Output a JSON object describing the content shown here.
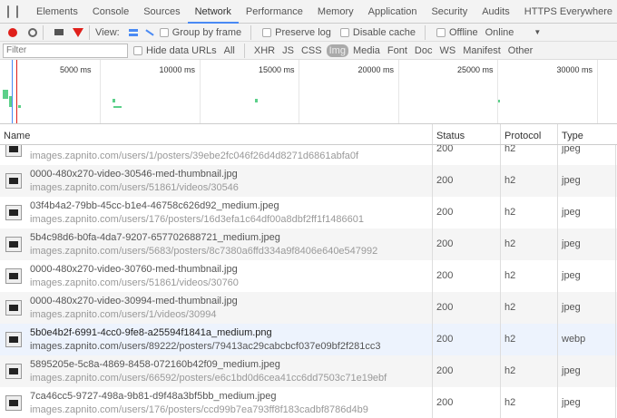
{
  "tabs": [
    "Elements",
    "Console",
    "Sources",
    "Network",
    "Performance",
    "Memory",
    "Application",
    "Security",
    "Audits",
    "HTTPS Everywhere"
  ],
  "active_tab": "Network",
  "toolbar": {
    "view_label": "View:",
    "group_by_frame": "Group by frame",
    "preserve_log": "Preserve log",
    "disable_cache": "Disable cache",
    "offline": "Offline",
    "throttle": "Online"
  },
  "filterbar": {
    "placeholder": "Filter",
    "hide_data_urls": "Hide data URLs",
    "types": [
      "All",
      "XHR",
      "JS",
      "CSS",
      "Img",
      "Media",
      "Font",
      "Doc",
      "WS",
      "Manifest",
      "Other"
    ],
    "selected_type": "Img"
  },
  "overview": {
    "ticks": [
      "5000 ms",
      "10000 ms",
      "15000 ms",
      "20000 ms",
      "25000 ms",
      "30000 ms"
    ]
  },
  "columns": {
    "name": "Name",
    "status": "Status",
    "protocol": "Protocol",
    "type": "Type"
  },
  "rows": [
    {
      "name": "",
      "path": "images.zapnito.com/users/1/posters/39ebe2fc046f26d4d8271d6861abfa0f",
      "status": "200",
      "protocol": "h2",
      "type": "jpeg"
    },
    {
      "name": "0000-480x270-video-30546-med-thumbnail.jpg",
      "path": "images.zapnito.com/users/51861/videos/30546",
      "status": "200",
      "protocol": "h2",
      "type": "jpeg"
    },
    {
      "name": "03f4b4a2-79bb-45cc-b1e4-46758c626d92_medium.jpeg",
      "path": "images.zapnito.com/users/176/posters/16d3efa1c64df00a8dbf2ff1f1486601",
      "status": "200",
      "protocol": "h2",
      "type": "jpeg"
    },
    {
      "name": "5b4c98d6-b0fa-4da7-9207-657702688721_medium.jpeg",
      "path": "images.zapnito.com/users/5683/posters/8c7380a6ffd334a9f8406e640e547992",
      "status": "200",
      "protocol": "h2",
      "type": "jpeg"
    },
    {
      "name": "0000-480x270-video-30760-med-thumbnail.jpg",
      "path": "images.zapnito.com/users/51861/videos/30760",
      "status": "200",
      "protocol": "h2",
      "type": "jpeg"
    },
    {
      "name": "0000-480x270-video-30994-med-thumbnail.jpg",
      "path": "images.zapnito.com/users/1/videos/30994",
      "status": "200",
      "protocol": "h2",
      "type": "jpeg"
    },
    {
      "name": "5b0e4b2f-6991-4cc0-9fe8-a25594f1841a_medium.png",
      "path": "images.zapnito.com/users/89222/posters/79413ac29cabcbcf037e09bf2f281cc3",
      "status": "200",
      "protocol": "h2",
      "type": "webp"
    },
    {
      "name": "5895205e-5c8a-4869-8458-072160b42f09_medium.jpeg",
      "path": "images.zapnito.com/users/66592/posters/e6c1bd0d6cea41cc6dd7503c71e19ebf",
      "status": "200",
      "protocol": "h2",
      "type": "jpeg"
    },
    {
      "name": "7ca46cc5-9727-498a-9b81-d9f48a3bf5bb_medium.jpeg",
      "path": "images.zapnito.com/users/176/posters/ccd99b7ea793ff8f183cadbf8786d4b9",
      "status": "200",
      "protocol": "h2",
      "type": "jpeg"
    }
  ],
  "selected_row": 6,
  "colors": {
    "accent": "#4a8af4",
    "record": "#e0201b",
    "waterfall": "#5cd08a"
  }
}
